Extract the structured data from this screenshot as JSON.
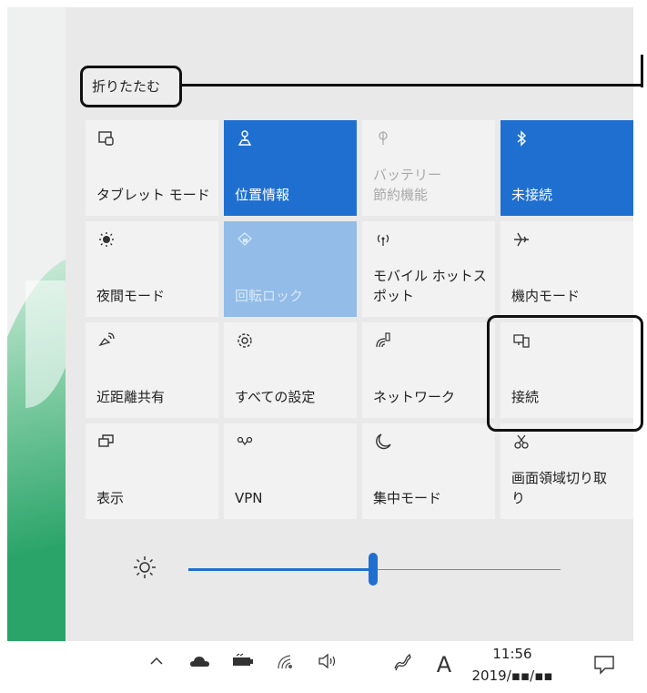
{
  "collapse_label": "折りたたむ",
  "tiles": [
    {
      "label": "タブレット モード",
      "icon": "tablet-mode-icon",
      "state": "normal"
    },
    {
      "label": "位置情報",
      "icon": "location-icon",
      "state": "active"
    },
    {
      "label": "バッテリー\n節約機能",
      "icon": "battery-saver-icon",
      "state": "disabled"
    },
    {
      "label": "未接続",
      "icon": "bluetooth-icon",
      "state": "active"
    },
    {
      "label": "夜間モード",
      "icon": "night-light-icon",
      "state": "normal"
    },
    {
      "label": "回転ロック",
      "icon": "rotation-lock-icon",
      "state": "disabled-active"
    },
    {
      "label": "モバイル ホットス\nポット",
      "icon": "mobile-hotspot-icon",
      "state": "normal"
    },
    {
      "label": "機内モード",
      "icon": "airplane-icon",
      "state": "normal"
    },
    {
      "label": "近距離共有",
      "icon": "nearby-share-icon",
      "state": "normal"
    },
    {
      "label": "すべての設定",
      "icon": "settings-gear-icon",
      "state": "normal"
    },
    {
      "label": "ネットワーク",
      "icon": "network-icon",
      "state": "normal"
    },
    {
      "label": "接続",
      "icon": "connect-icon",
      "state": "normal"
    },
    {
      "label": "表示",
      "icon": "project-icon",
      "state": "normal"
    },
    {
      "label": "VPN",
      "icon": "vpn-icon",
      "state": "normal"
    },
    {
      "label": "集中モード",
      "icon": "focus-assist-icon",
      "state": "normal"
    },
    {
      "label": "画面領域切り取\nり",
      "icon": "screen-snip-icon",
      "state": "normal"
    }
  ],
  "brightness": {
    "icon": "brightness-icon",
    "level_fraction": 0.5
  },
  "taskbar": {
    "time": "11:56",
    "date": "2019/▪▪/▪▪",
    "ime": "A",
    "icons": [
      "chevron-up-icon",
      "onedrive-icon",
      "battery-icon",
      "wifi-icon",
      "volume-icon",
      "pen-icon",
      "ime-icon",
      "notifications-icon"
    ]
  },
  "colors": {
    "accent": "#1f6fd0",
    "accent_disabled": "#93bde8",
    "panel": "#e9e9e9",
    "tile": "#f2f2f2"
  }
}
